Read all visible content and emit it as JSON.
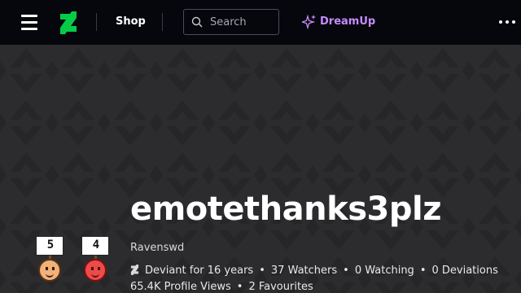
{
  "nav": {
    "shop_label": "Shop",
    "search_placeholder": "Search",
    "dreamup_label": "DreamUp",
    "accent_color": "#05cc47",
    "dreamup_color": "#c88bff"
  },
  "profile": {
    "username": "emotethanks3plz",
    "real_name": "Ravenswd",
    "deviant_for": "Deviant for 16 years",
    "watchers": "37 Watchers",
    "watching": "0 Watching",
    "deviations": "0 Deviations",
    "profile_views": "65.4K Profile Views",
    "favourites": "2 Favourites"
  },
  "emotes": [
    {
      "sign": "5",
      "face_color": "#f1b27a"
    },
    {
      "sign": "4",
      "face_color": "#ef4a4a"
    }
  ],
  "icons": [
    "hamburger-icon",
    "deviantart-logo-icon",
    "search-icon",
    "sparkle-icon",
    "more-icon"
  ]
}
